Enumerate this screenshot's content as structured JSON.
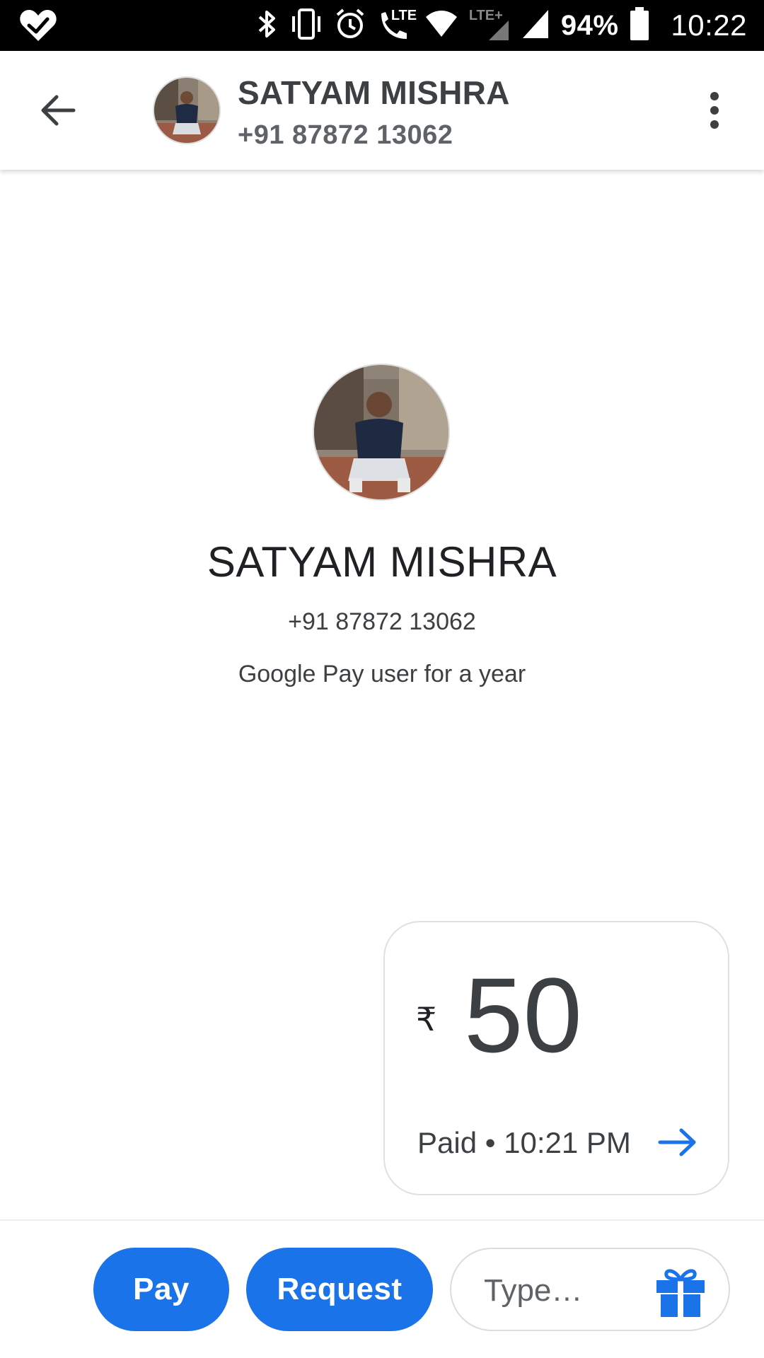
{
  "status_bar": {
    "battery": "94%",
    "time": "10:22",
    "network_label": "LTE+",
    "call_label": "LTE",
    "icons": [
      "heart-check-icon",
      "bluetooth-icon",
      "vibrate-icon",
      "alarm-icon",
      "volte-call-icon",
      "wifi-icon",
      "signal-icon",
      "signal-icon",
      "battery-icon"
    ]
  },
  "header": {
    "back_icon": "arrow-back-icon",
    "name": "SATYAM MISHRA",
    "phone": "+91 87872 13062",
    "more_icon": "more-vert-icon"
  },
  "profile": {
    "name": "SATYAM MISHRA",
    "phone": "+91 87872 13062",
    "since": "Google Pay user for a year"
  },
  "payment": {
    "currency": "₹",
    "amount": "50",
    "status": "Paid • 10:21 PM",
    "arrow_icon": "arrow-forward-icon"
  },
  "bottom_bar": {
    "pay_label": "Pay",
    "request_label": "Request",
    "type_placeholder": "Type…",
    "gift_icon": "gift-icon"
  },
  "colors": {
    "accent": "#1a73e8",
    "status_bar": "#000000",
    "text_primary": "#202124",
    "text_secondary": "#5f6368"
  }
}
